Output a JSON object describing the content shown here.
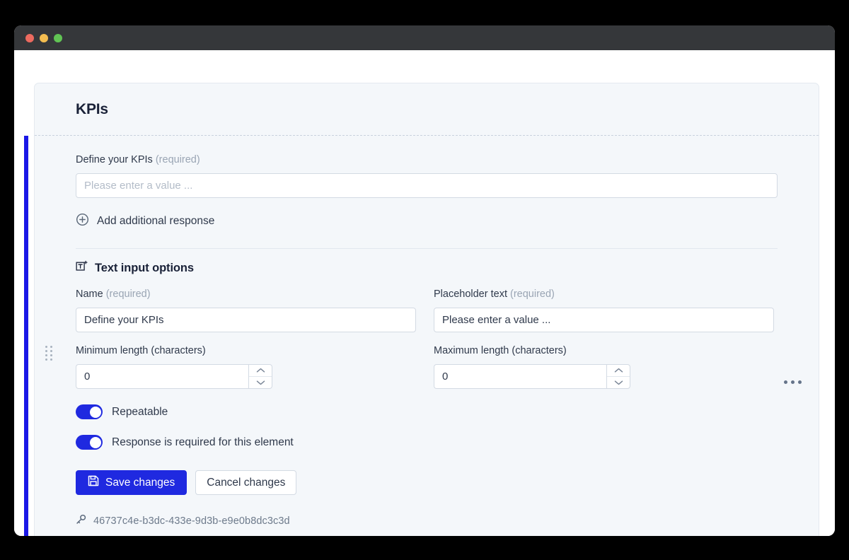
{
  "window": {
    "traffic_lights": [
      {
        "name": "close",
        "color": "#ec6a5f"
      },
      {
        "name": "minimize",
        "color": "#f4bd50"
      },
      {
        "name": "maximize",
        "color": "#61c454"
      }
    ]
  },
  "card": {
    "title": "KPIs",
    "accent_color": "#1a17e6"
  },
  "question": {
    "label": "Define your KPIs",
    "required_tag": "(required)",
    "input_value": "",
    "input_placeholder": "Please enter a value ...",
    "add_response_label": "Add additional response",
    "add_response_icon": "plus-circle-icon"
  },
  "options": {
    "icon": "text-input-icon",
    "title": "Text input options",
    "fields": {
      "name": {
        "label": "Name",
        "required_tag": "(required)",
        "value": "Define your KPIs",
        "placeholder": "Please enter a value ..."
      },
      "placeholder_text": {
        "label": "Placeholder text",
        "required_tag": "(required)",
        "value": "Please enter a value ...",
        "placeholder": "Please enter a value ..."
      },
      "min_length": {
        "label": "Minimum length (characters)",
        "value": "0"
      },
      "max_length": {
        "label": "Maximum length (characters)",
        "value": "0"
      }
    },
    "toggles": [
      {
        "label": "Repeatable",
        "on": true
      },
      {
        "label": "Response is required for this element",
        "on": true
      }
    ],
    "buttons": {
      "save_label": "Save changes",
      "save_icon": "floppy-disk-icon",
      "cancel_label": "Cancel changes"
    },
    "uuid": {
      "icon": "key-icon",
      "value": "46737c4e-b3dc-433e-9d3b-e9e0b8dc3c3d"
    }
  },
  "controls": {
    "drag_handle": "drag-handle-icon",
    "more_options": "more-options-icon"
  },
  "colors": {
    "accent_blue": "#1f29e0",
    "card_background": "#f4f7fa",
    "titlebar": "#35373a"
  }
}
